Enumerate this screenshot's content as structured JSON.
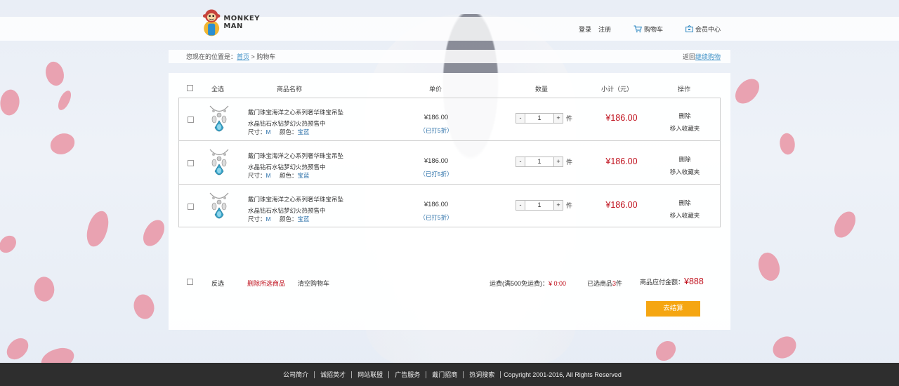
{
  "brand": {
    "logo_line1": "MONKEY",
    "logo_line2": "MAN"
  },
  "top_nav": {
    "login": "登录",
    "register": "注册",
    "cart": "购物车",
    "member": "会员中心"
  },
  "breadcrumb": {
    "prefix": "您现在的位置是：",
    "home": "首页",
    "separator": " > ",
    "current": "购物车",
    "back_prefix": "返回",
    "back_link": "继续购物"
  },
  "cart_header": {
    "select_all": "全选",
    "product_name": "商品名称",
    "unit_price": "单价",
    "quantity": "数量",
    "subtotal": "小计（元）",
    "operation": "操作"
  },
  "items": [
    {
      "name_line1": "戴门珠宝海洋之心系列奢华珠宝吊坠",
      "name_line2": "水晶钻石水钻梦幻火热预售中",
      "size_label": "尺寸：",
      "size": "M",
      "color_label": "颜色：",
      "color": "宝蓝",
      "price": "¥186.00",
      "discount": "（已打5折）",
      "qty_minus": "-",
      "qty": "1",
      "qty_plus": "+",
      "unit": "件",
      "subtotal": "¥186.00",
      "delete": "删除",
      "favorite": "移入收藏夹"
    },
    {
      "name_line1": "戴门珠宝海洋之心系列奢华珠宝吊坠",
      "name_line2": "水晶钻石水钻梦幻火热预售中",
      "size_label": "尺寸：",
      "size": "M",
      "color_label": "颜色：",
      "color": "宝蓝",
      "price": "¥186.00",
      "discount": "（已打5折）",
      "qty_minus": "-",
      "qty": "1",
      "qty_plus": "+",
      "unit": "件",
      "subtotal": "¥186.00",
      "delete": "删除",
      "favorite": "移入收藏夹"
    },
    {
      "name_line1": "戴门珠宝海洋之心系列奢华珠宝吊坠",
      "name_line2": "水晶钻石水钻梦幻火热预售中",
      "size_label": "尺寸：",
      "size": "M",
      "color_label": "颜色：",
      "color": "宝蓝",
      "price": "¥186.00",
      "discount": "（已打5折）",
      "qty_minus": "-",
      "qty": "1",
      "qty_plus": "+",
      "unit": "件",
      "subtotal": "¥186.00",
      "delete": "删除",
      "favorite": "移入收藏夹"
    }
  ],
  "cart_footer": {
    "invert_select": "反选",
    "delete_selected": "删除所选商品",
    "clear_cart": "清空购物车",
    "shipping_label": "运费(满500免运费)：",
    "shipping_value": "¥ 0:00",
    "selected_label": "已选商品",
    "selected_count": "3",
    "selected_unit": "件",
    "total_label": "商品应付金额：",
    "total_value": "¥888",
    "checkout": "去结算"
  },
  "footer": {
    "links": [
      "公司简介",
      "诚招英才",
      "网站联盟",
      "广告服务",
      "戴门招商",
      "热词搜索"
    ],
    "copyright": "Copyright   2001-2016, All Rights Reserved"
  },
  "colors": {
    "accent_blue": "#3b8fc6",
    "price_red": "#c0121e",
    "checkout_orange": "#f5a612",
    "footer_bg": "#2e2e2e"
  }
}
